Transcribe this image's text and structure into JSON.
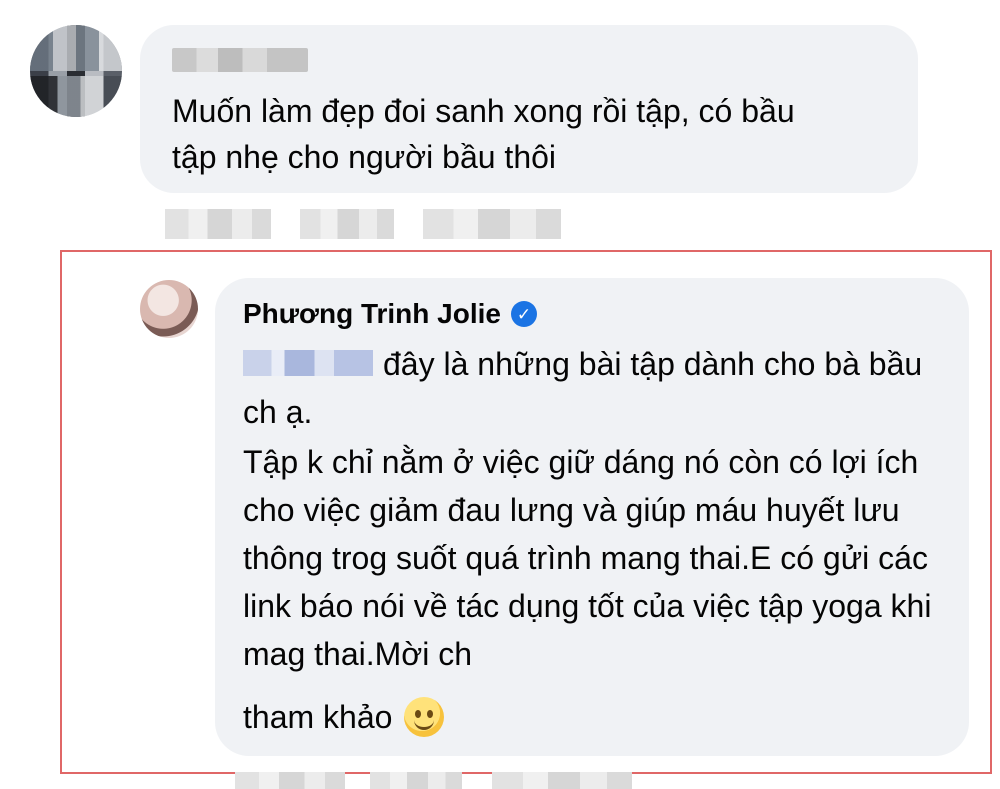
{
  "comment": {
    "text_line1": "Muốn làm đẹp đoi sanh xong rồi tập, có bầu",
    "text_line2": "tập nhẹ cho người bầu thôi"
  },
  "reply": {
    "author": "Phương Trinh Jolie",
    "verified_icon": "✓",
    "first_line": "đây là những bài tập dành cho bà bầu ch ạ.",
    "body": "Tập k chỉ nằm ở việc giữ dáng nó còn có lợi ích cho việc giảm đau lưng và giúp máu huyết lưu thông trog suốt quá trình mang thai.E có gửi các link báo nói về tác dụng tốt của việc tập yoga khi mag thai.Mời ch",
    "last_line": "tham khảo",
    "emoji_icon": "smile-icon"
  },
  "colors": {
    "bubble_bg": "#f0f2f5",
    "highlight_border": "#e06767",
    "verified_blue": "#1b74e4"
  }
}
